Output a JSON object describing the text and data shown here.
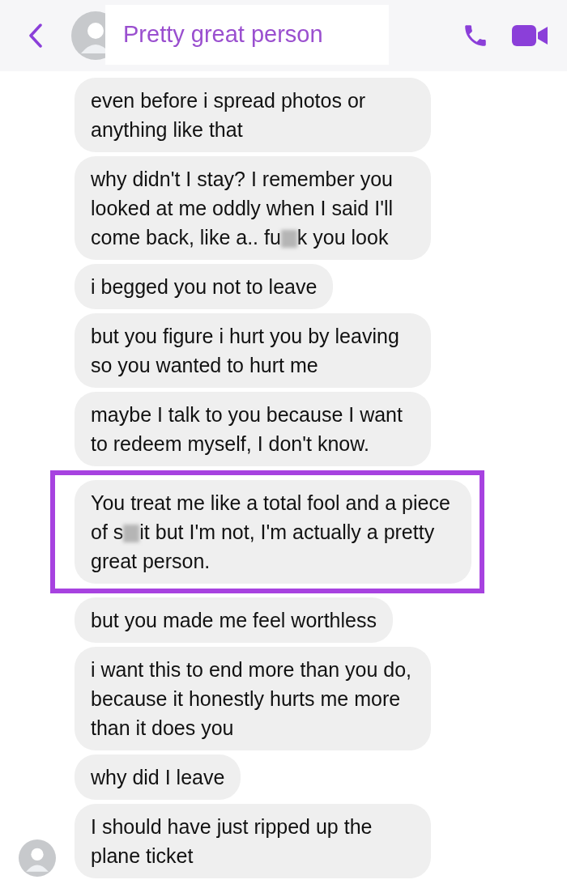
{
  "header": {
    "title": "Pretty great person"
  },
  "messages": [
    {
      "segments": [
        "even before i spread photos or anything like that"
      ],
      "highlighted": false,
      "avatar": false
    },
    {
      "segments": [
        "why didn't I stay? I remember you looked at me oddly when I said I'll come back, like a.. fu",
        "k you look"
      ],
      "highlighted": false,
      "avatar": false
    },
    {
      "segments": [
        "i begged you not to leave"
      ],
      "highlighted": false,
      "avatar": false
    },
    {
      "segments": [
        "but you figure i hurt you by leaving so you wanted to hurt me"
      ],
      "highlighted": false,
      "avatar": false
    },
    {
      "segments": [
        "maybe I talk to you because I want to redeem myself, I don't know."
      ],
      "highlighted": false,
      "avatar": false
    },
    {
      "segments": [
        "You treat me like a total fool and a piece of s",
        "it but I'm not, I'm actually a pretty great person."
      ],
      "highlighted": true,
      "avatar": false
    },
    {
      "segments": [
        "but you made me feel worthless"
      ],
      "highlighted": false,
      "avatar": false
    },
    {
      "segments": [
        "i want this to end more than you do, because it honestly hurts me more than it does you"
      ],
      "highlighted": false,
      "avatar": false
    },
    {
      "segments": [
        "why did I leave"
      ],
      "highlighted": false,
      "avatar": false
    },
    {
      "segments": [
        "I should have just ripped up the plane ticket"
      ],
      "highlighted": false,
      "avatar": true
    }
  ]
}
